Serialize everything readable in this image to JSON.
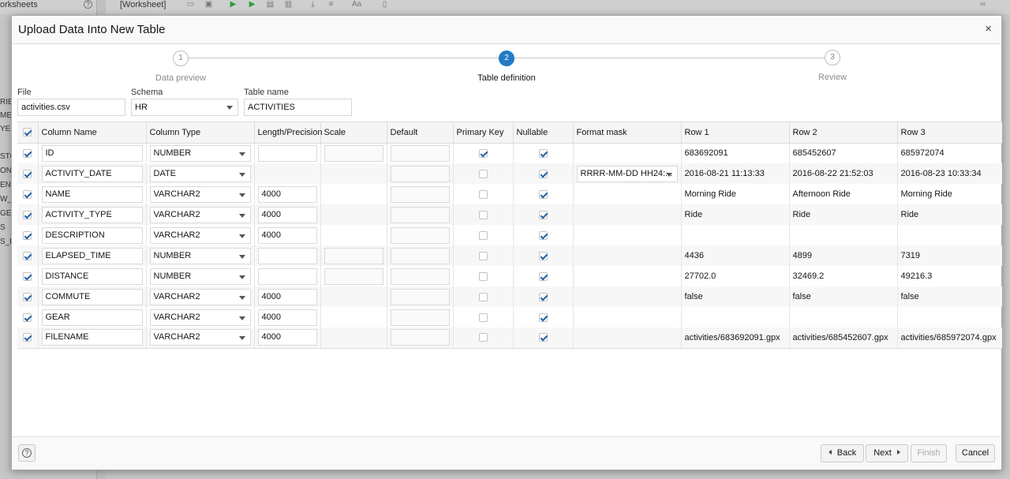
{
  "background": {
    "worksheets_label": "orksheets",
    "worksheet_tab": "[Worksheet]",
    "left_labels": [
      "RIE",
      "ME",
      "YEE",
      "STO",
      "ONS",
      "ENT",
      "W_",
      "GE",
      "S",
      "S_L"
    ]
  },
  "dialog": {
    "title": "Upload Data Into New Table",
    "close": "×"
  },
  "train": {
    "steps": [
      {
        "number": "1",
        "label": "Data preview"
      },
      {
        "number": "2",
        "label": "Table definition"
      },
      {
        "number": "3",
        "label": "Review"
      }
    ]
  },
  "form": {
    "file_label": "File",
    "file_value": "activities.csv",
    "schema_label": "Schema",
    "schema_value": "HR",
    "table_label": "Table name",
    "table_value": "ACTIVITIES"
  },
  "grid": {
    "headers": [
      "Column Name",
      "Column Type",
      "Length/Precision",
      "Scale",
      "Default",
      "Primary Key",
      "Nullable",
      "Format mask",
      "Row 1",
      "Row 2",
      "Row 3"
    ],
    "rows": [
      {
        "name": "ID",
        "type": "NUMBER",
        "length": "",
        "scale_input": true,
        "pk": true,
        "nullable": true,
        "format": "",
        "r1": "683692091",
        "r2": "685452607",
        "r3": "685972074"
      },
      {
        "name": "ACTIVITY_DATE",
        "type": "DATE",
        "length": null,
        "scale_input": false,
        "pk": false,
        "nullable": true,
        "format": "RRRR-MM-DD HH24:...",
        "r1": "2016-08-21 11:13:33",
        "r2": "2016-08-22 21:52:03",
        "r3": "2016-08-23 10:33:34"
      },
      {
        "name": "NAME",
        "type": "VARCHAR2",
        "length": "4000",
        "scale_input": false,
        "pk": false,
        "nullable": true,
        "format": "",
        "r1": "Morning Ride",
        "r2": "Afternoon Ride",
        "r3": "Morning Ride"
      },
      {
        "name": "ACTIVITY_TYPE",
        "type": "VARCHAR2",
        "length": "4000",
        "scale_input": false,
        "pk": false,
        "nullable": true,
        "format": "",
        "r1": "Ride",
        "r2": "Ride",
        "r3": "Ride"
      },
      {
        "name": "DESCRIPTION",
        "type": "VARCHAR2",
        "length": "4000",
        "scale_input": false,
        "pk": false,
        "nullable": true,
        "format": "",
        "r1": "",
        "r2": "",
        "r3": ""
      },
      {
        "name": "ELAPSED_TIME",
        "type": "NUMBER",
        "length": "",
        "scale_input": true,
        "pk": false,
        "nullable": true,
        "format": "",
        "r1": "4436",
        "r2": "4899",
        "r3": "7319"
      },
      {
        "name": "DISTANCE",
        "type": "NUMBER",
        "length": "",
        "scale_input": true,
        "pk": false,
        "nullable": true,
        "format": "",
        "r1": "27702.0",
        "r2": "32469.2",
        "r3": "49216.3"
      },
      {
        "name": "COMMUTE",
        "type": "VARCHAR2",
        "length": "4000",
        "scale_input": false,
        "pk": false,
        "nullable": true,
        "format": "",
        "r1": "false",
        "r2": "false",
        "r3": "false"
      },
      {
        "name": "GEAR",
        "type": "VARCHAR2",
        "length": "4000",
        "scale_input": false,
        "pk": false,
        "nullable": true,
        "format": "",
        "r1": "",
        "r2": "",
        "r3": ""
      },
      {
        "name": "FILENAME",
        "type": "VARCHAR2",
        "length": "4000",
        "scale_input": false,
        "pk": false,
        "nullable": true,
        "format": "",
        "r1": "activities/683692091.gpx",
        "r2": "activities/685452607.gpx",
        "r3": "activities/685972074.gpx"
      }
    ]
  },
  "footer": {
    "help": "?",
    "back": "Back",
    "next": "Next",
    "finish": "Finish",
    "cancel": "Cancel"
  },
  "colors": {
    "accent": "#227bc4",
    "check": "#1f64a8"
  }
}
